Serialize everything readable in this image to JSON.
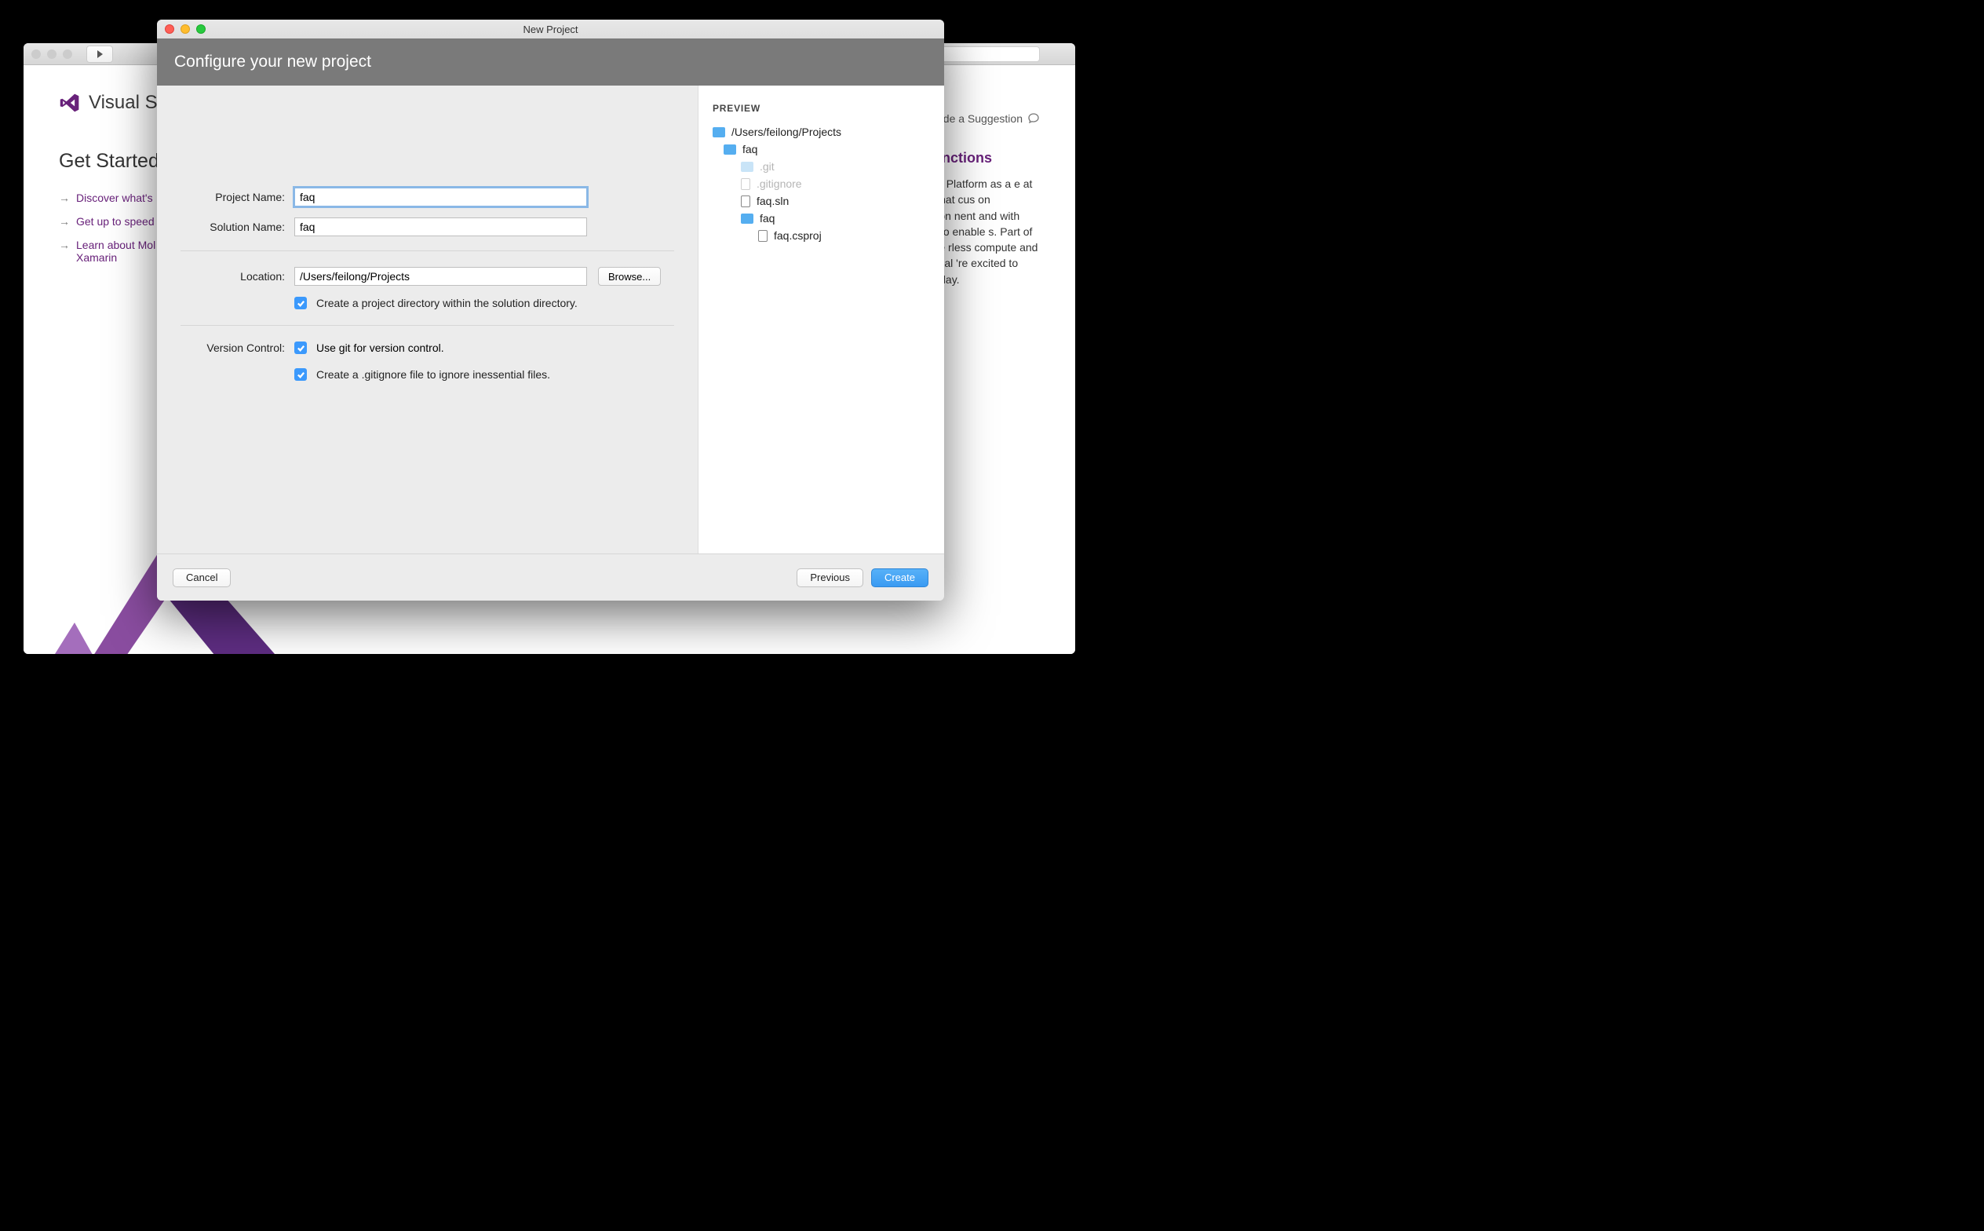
{
  "parent": {
    "brand": "Visual Stu",
    "getStarted": "Get Started",
    "links": [
      "Discover what's",
      "Get up to speed",
      "Learn about Mol\nXamarin"
    ],
    "suggest": "ide a Suggestion",
    "rightHeading": "ure Functions",
    "rightBody": "ot only to Platform as a e at a scale that cus on application nent and with PaaS in to enable s. Part of the Azure rless compute and operational 're excited to ctions today."
  },
  "dialog": {
    "title": "New Project",
    "header": "Configure your new project",
    "labels": {
      "projectName": "Project Name:",
      "solutionName": "Solution Name:",
      "location": "Location:",
      "versionControl": "Version Control:"
    },
    "values": {
      "projectName": "faq",
      "solutionName": "faq",
      "location": "/Users/feilong/Projects"
    },
    "browse": "Browse...",
    "checks": {
      "createDir": "Create a project directory within the solution directory.",
      "useGit": "Use git for version control.",
      "gitignore": "Create a .gitignore file to ignore inessential files."
    },
    "preview": {
      "title": "PREVIEW",
      "root": "/Users/feilong/Projects",
      "solDir": "faq",
      "gitDir": ".git",
      "gitignore": ".gitignore",
      "sln": "faq.sln",
      "projDir": "faq",
      "csproj": "faq.csproj"
    },
    "buttons": {
      "cancel": "Cancel",
      "previous": "Previous",
      "create": "Create"
    }
  }
}
